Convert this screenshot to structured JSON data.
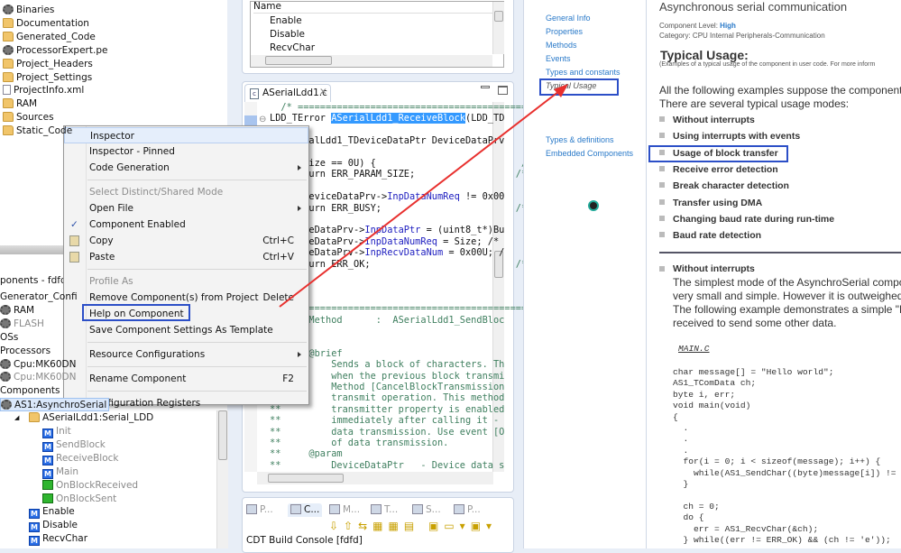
{
  "project_tree": [
    {
      "label": "Binaries",
      "icon": "binaries-icon"
    },
    {
      "label": "Documentation",
      "icon": "folder-icon"
    },
    {
      "label": "Generated_Code",
      "icon": "folder-icon"
    },
    {
      "label": "ProcessorExpert.pe",
      "icon": "chip-file-icon"
    },
    {
      "label": "Project_Headers",
      "icon": "folder-icon"
    },
    {
      "label": "Project_Settings",
      "icon": "folder-icon"
    },
    {
      "label": "ProjectInfo.xml",
      "icon": "file-icon"
    },
    {
      "label": "RAM",
      "icon": "folder-icon"
    },
    {
      "label": "Sources",
      "icon": "folder-icon"
    },
    {
      "label": "Static_Code",
      "icon": "folder-icon"
    }
  ],
  "components_panel": {
    "title": "ponents - fdfd",
    "items": [
      {
        "label": "Generator_Confi",
        "indent": 0,
        "icon": "",
        "state": "normal"
      },
      {
        "label": "RAM",
        "indent": 0,
        "icon": "gear",
        "state": "normal"
      },
      {
        "label": "FLASH",
        "indent": 0,
        "icon": "gear",
        "state": "disabled"
      },
      {
        "label": "OSs",
        "indent": 0,
        "icon": "",
        "state": "normal"
      },
      {
        "label": "Processors",
        "indent": 0,
        "icon": "",
        "state": "normal"
      },
      {
        "label": "Cpu:MK60DN",
        "indent": 0,
        "icon": "gear",
        "state": "normal"
      },
      {
        "label": "Cpu:MK60DN",
        "indent": 0,
        "icon": "gear",
        "state": "disabled"
      },
      {
        "label": "Components",
        "indent": 0,
        "icon": "",
        "state": "normal"
      },
      {
        "label": "AS1:AsynchroSerial",
        "indent": 0,
        "icon": "gear",
        "state": "selected"
      },
      {
        "label": "ASerialLdd1:Serial_LDD",
        "indent": 1,
        "icon": "component",
        "state": "normal"
      },
      {
        "label": "Init",
        "indent": 2,
        "icon": "method",
        "state": "disabled"
      },
      {
        "label": "SendBlock",
        "indent": 2,
        "icon": "method",
        "state": "disabled"
      },
      {
        "label": "ReceiveBlock",
        "indent": 2,
        "icon": "method",
        "state": "disabled"
      },
      {
        "label": "Main",
        "indent": 2,
        "icon": "method",
        "state": "disabled"
      },
      {
        "label": "OnBlockReceived",
        "indent": 2,
        "icon": "event",
        "state": "disabled"
      },
      {
        "label": "OnBlockSent",
        "indent": 2,
        "icon": "event",
        "state": "disabled"
      },
      {
        "label": "Enable",
        "indent": 1,
        "icon": "method",
        "state": "normal"
      },
      {
        "label": "Disable",
        "indent": 1,
        "icon": "method",
        "state": "normal"
      },
      {
        "label": "RecvChar",
        "indent": 1,
        "icon": "method",
        "state": "normal"
      }
    ]
  },
  "context_menu": [
    {
      "label": "Inspector",
      "hover": true
    },
    {
      "label": "Inspector - Pinned"
    },
    {
      "label": "Code Generation",
      "submenu": true
    },
    {
      "sep": true
    },
    {
      "label": "Select Distinct/Shared Mode",
      "disabled": true
    },
    {
      "label": "Open File",
      "submenu": true
    },
    {
      "label": "Component Enabled",
      "checked": true
    },
    {
      "label": "Copy",
      "shortcut": "Ctrl+C",
      "icon": "copy-icon"
    },
    {
      "label": "Paste",
      "shortcut": "Ctrl+V",
      "icon": "paste-icon"
    },
    {
      "sep": true
    },
    {
      "label": "Profile As",
      "disabled": true
    },
    {
      "label": "Remove Component(s) from Project",
      "shortcut": "Delete"
    },
    {
      "label": "Help on Component",
      "boxed": true
    },
    {
      "label": "Save Component Settings As Template"
    },
    {
      "sep": true
    },
    {
      "label": "Resource Configurations",
      "submenu": true
    },
    {
      "sep": true
    },
    {
      "label": "Rename Component",
      "shortcut": "F2"
    },
    {
      "sep": true
    },
    {
      "label": "Configuration Registers"
    }
  ],
  "methods_table": {
    "header": "Name",
    "rows": [
      "Enable",
      "Disable",
      "RecvChar"
    ]
  },
  "editor": {
    "tab": "ASerialLdd1.c",
    "lines": [
      [
        [
          "  /* ===============================================",
          "cm"
        ]
      ],
      [
        [
          "LDD_TError ",
          "kw"
        ],
        [
          "ASerialLdd1_ReceiveBlock",
          "hl"
        ],
        [
          "(LDD_TD",
          "kw"
        ]
      ],
      [],
      [
        [
          "  ASerialLdd1_TDeviceDataPtr DeviceDataPrv",
          "kw"
        ]
      ],
      [],
      [
        [
          "  if (Size == 0U) {                          ",
          "kw"
        ],
        [
          "/*",
          "cm"
        ]
      ],
      [
        [
          "    return ERR_PARAM_SIZE;                  ",
          "kw"
        ],
        [
          "/*",
          "cm"
        ]
      ],
      [],
      [
        [
          "  if (DeviceDataPrv->",
          "kw"
        ],
        [
          "InpDataNumReq",
          "fld"
        ],
        [
          " != 0x00",
          "kw"
        ]
      ],
      [
        [
          "    return ERR_BUSY;                        ",
          "kw"
        ],
        [
          "/*",
          "cm"
        ]
      ],
      [],
      [
        [
          "  DeviceDataPrv->",
          "kw"
        ],
        [
          "InpDataPtr",
          "fld"
        ],
        [
          " = (uint8_t*)Bu",
          "kw"
        ]
      ],
      [
        [
          "  DeviceDataPrv->",
          "kw"
        ],
        [
          "InpDataNumReq",
          "fld"
        ],
        [
          " = Size; /*",
          "kw"
        ]
      ],
      [
        [
          "  DeviceDataPrv->",
          "kw"
        ],
        [
          "InpRecvDataNum",
          "fld"
        ],
        [
          " = 0x00U; /",
          "kw"
        ]
      ],
      [
        [
          "    return ERR_OK;                          ",
          "kw"
        ],
        [
          "/*",
          "cm"
        ]
      ],
      [],
      [],
      [],
      [
        [
          "=================================================",
          "cm"
        ]
      ],
      [
        [
          "**     Method      :  ASerialLdd1_SendBloc",
          "cm"
        ]
      ],
      [
        [
          "**",
          "cm"
        ]
      ],
      [
        [
          "**",
          "cm"
        ]
      ],
      [
        [
          "**     @brief",
          "cm"
        ]
      ],
      [
        [
          "**         Sends a block of characters. Th",
          "cm"
        ]
      ],
      [
        [
          "**         when the previous block transmi",
          "cm"
        ]
      ],
      [
        [
          "**         Method [CancelBlockTransmission",
          "cm"
        ]
      ],
      [
        [
          "**         transmit operation. This method",
          "cm"
        ]
      ],
      [
        [
          "**         transmitter property is enabled",
          "cm"
        ]
      ],
      [
        [
          "**         immediately after calling it -",
          "cm"
        ]
      ],
      [
        [
          "**         data transmission. Use event [O",
          "cm"
        ]
      ],
      [
        [
          "**         of data transmission.",
          "cm"
        ]
      ],
      [
        [
          "**     @param",
          "cm"
        ]
      ],
      [
        [
          "**         DeviceDataPtr   - Device data s",
          "cm"
        ]
      ]
    ]
  },
  "console": {
    "tabs": [
      "P...",
      "C...",
      "M...",
      "T...",
      "S...",
      "P..."
    ],
    "title": "CDT Build Console [fdfd]"
  },
  "help_nav": {
    "links": [
      "General Info",
      "Properties",
      "Methods",
      "Events",
      "Types and constants",
      "Typical Usage"
    ],
    "links2": [
      "Types & definitions",
      "Embedded Components"
    ]
  },
  "help": {
    "title": "Asynchronous serial communication",
    "level_label": "Component Level:",
    "level": "High",
    "category_label": "Category:",
    "category": "CPU Internal Peripherals-Communication",
    "section": "Typical Usage:",
    "section_sub": "(Examples of a typical usage of the component in user code. For more inform",
    "intro1": "All the following examples suppose the component",
    "intro2": "There are several typical usage modes:",
    "modes": [
      "Without interrupts",
      "Using interrupts with events",
      "Usage of block transfer",
      "Receive error detection",
      "Break character detection",
      "Transfer using DMA",
      "Changing baud rate during run-time",
      "Baud rate detection"
    ],
    "sub_title": "Without interrupts",
    "sub_text": [
      "The simplest mode of the AsynchroSerial compon",
      "very small and simple. However it is outweighed",
      "The following example demonstrates a simple \"H",
      "received to send some other data."
    ],
    "file": "MAIN.C",
    "example": [
      "char message[] = \"Hello world\";",
      "AS1_TComData ch;",
      "byte i, err;",
      "void main(void)",
      "{",
      "  .",
      "  .",
      "  .",
      "  for(i = 0; i < sizeof(message); i++) {",
      "    while(AS1_SendChar((byte)message[i]) !=",
      "  }",
      "",
      "  ch = 0;",
      "  do {",
      "    err = AS1_RecvChar(&ch);",
      "  } while((err != ERR_OK) && (ch != 'e'));"
    ]
  },
  "colors": {
    "annotation_box": "#2c4fc7",
    "arrow": "#e8302e",
    "link": "#2a7ac9",
    "selection": "#3399ff"
  }
}
